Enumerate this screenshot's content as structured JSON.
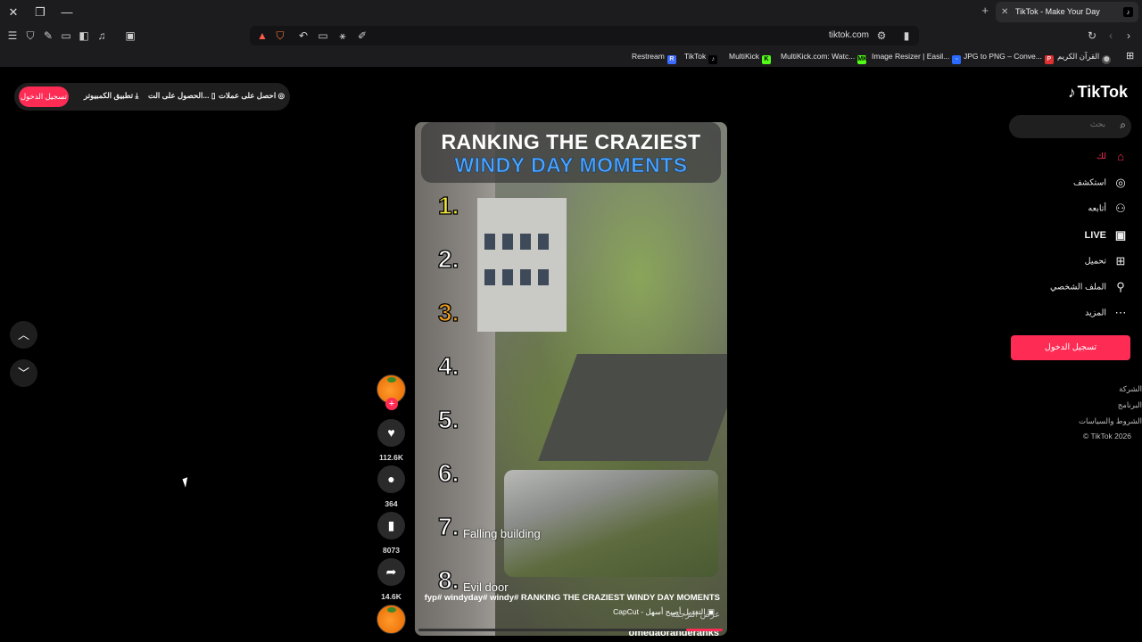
{
  "browser": {
    "tab_title": "TikTok - Make Your Day",
    "url": "tiktok.com",
    "bookmarks": [
      "Restream",
      "TikTok",
      "MultiKick",
      "MultiKick.com: Watc...",
      "Image Resizer | Easil...",
      "JPG to PNG – Conve...",
      "القرآن الكريم"
    ]
  },
  "topbar": {
    "login": "تسجيل الدخول",
    "desktop_app": "تطبيق الكمبيوتر",
    "get_app": "الحصول على الت...",
    "get_coins": "احصل على عملات"
  },
  "sidebar": {
    "logo": "TikTok",
    "search_placeholder": "بحث",
    "nav": [
      {
        "label": "لك",
        "icon": "home-icon"
      },
      {
        "label": "استكشف",
        "icon": "explore-icon"
      },
      {
        "label": "أتابعه",
        "icon": "following-icon"
      },
      {
        "label": "LIVE",
        "icon": "live-icon"
      },
      {
        "label": "تحميل",
        "icon": "upload-icon"
      },
      {
        "label": "الملف الشخصي",
        "icon": "profile-icon"
      },
      {
        "label": "المزيد",
        "icon": "more-icon"
      }
    ],
    "login_button": "تسجيل الدخول",
    "footer": [
      "الشركة",
      "البرنامج",
      "الشروط والسياسات",
      "© TikTok 2026"
    ]
  },
  "video": {
    "title_line1": "RANKING THE CRAZIEST",
    "title_line2": "WINDY DAY MOMENTS",
    "ranks": [
      "1.",
      "2.",
      "3.",
      "4.",
      "5.",
      "6.",
      "7.",
      "8."
    ],
    "rank7_label": "Falling building",
    "rank8_label": "Evil door",
    "capcut": "CapCut - التعديل أصبح أسهل",
    "username": "omegaorangeranks",
    "description": "fyp# windyday# windy# RANKING THE CRAZIEST WINDY DAY MOMENTS",
    "translate": "عرض الترجمة",
    "progress": 0.12
  },
  "actions": {
    "likes": "112.6K",
    "comments": "364",
    "saves": "8073",
    "shares": "14.6K"
  },
  "colors": {
    "accent": "#fe2c55",
    "title_blue": "#4aa3ff"
  }
}
